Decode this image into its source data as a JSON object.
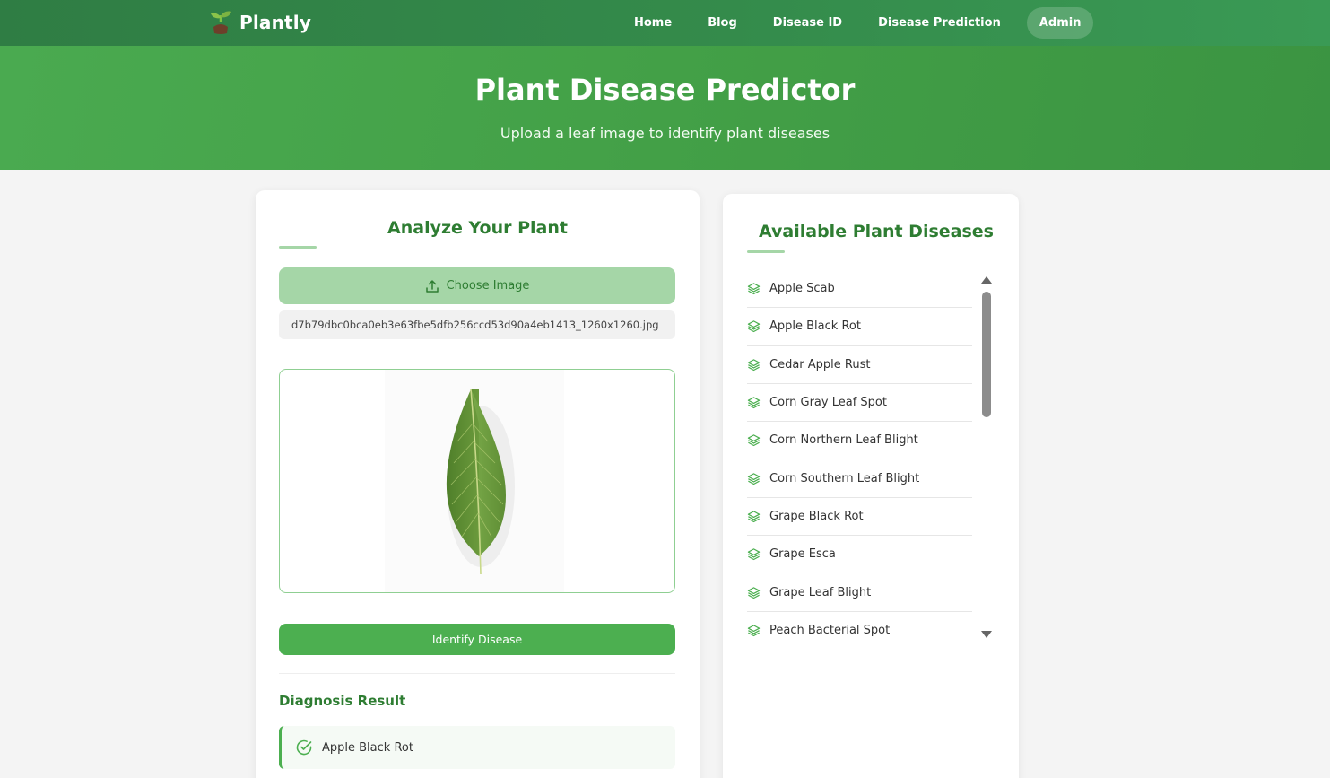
{
  "nav": {
    "brand": "Plantly",
    "links": [
      "Home",
      "Blog",
      "Disease ID",
      "Disease Prediction"
    ],
    "admin": "Admin"
  },
  "hero": {
    "title": "Plant Disease Predictor",
    "subtitle": "Upload a leaf image to identify plant diseases"
  },
  "analyze": {
    "title": "Analyze Your Plant",
    "choose_label": "Choose Image",
    "filename": "d7b79dbc0bca0eb3e63fbe5dfb256ccd53d90a4eb1413_1260x1260.jpg",
    "identify_label": "Identify Disease",
    "diagnosis_title": "Diagnosis Result",
    "result": "Apple Black Rot"
  },
  "diseases": {
    "title": "Available Plant Diseases",
    "items": [
      "Apple Scab",
      "Apple Black Rot",
      "Cedar Apple Rust",
      "Corn Gray Leaf Spot",
      "Corn Northern Leaf Blight",
      "Corn Southern Leaf Blight",
      "Grape Black Rot",
      "Grape Esca",
      "Grape Leaf Blight",
      "Peach Bacterial Spot"
    ]
  },
  "colors": {
    "nav_bg": "#348b4b",
    "hero_bg": "#43a047",
    "accent": "#4caf50",
    "title_green": "#2e7d32",
    "light_green": "#a5d6a7"
  },
  "icons": {
    "brand": "sprout-icon",
    "upload": "upload-icon",
    "layers": "layers-icon",
    "check": "check-circle-icon"
  }
}
